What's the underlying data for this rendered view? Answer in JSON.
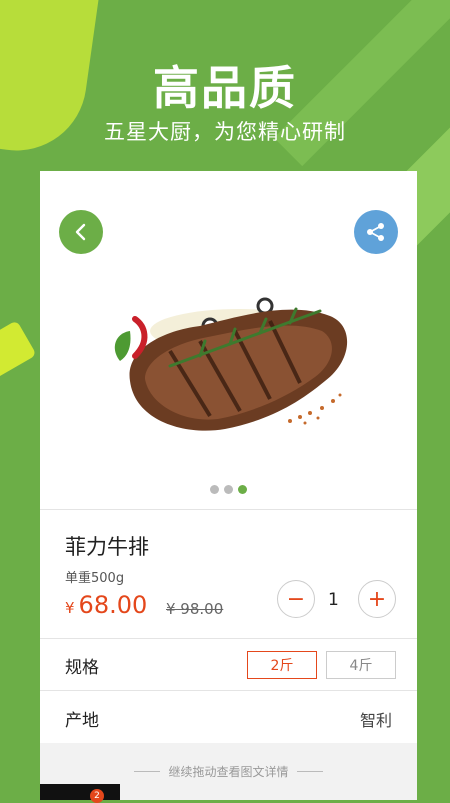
{
  "promo": {
    "headline": "高品质",
    "subline": "五星大厨，为您精心研制"
  },
  "product": {
    "name": "菲力牛排",
    "weight": "单重500g",
    "currency": "¥",
    "price": "68.00",
    "old_price": "¥ 98.00",
    "quantity": "1",
    "minus_label": "−",
    "plus_label": "+"
  },
  "carousel": {
    "count": 3,
    "active_index": 2
  },
  "spec": {
    "label": "规格",
    "options": [
      "2斤",
      "4斤"
    ],
    "selected": "2斤"
  },
  "origin": {
    "label": "产地",
    "value": "智利"
  },
  "footer": {
    "hint": "继续拖动查看图文详情"
  },
  "cart": {
    "badge": "2"
  },
  "colors": {
    "brand_green": "#6cae47",
    "accent_orange": "#e4471b",
    "share_blue": "#5fa2d9"
  },
  "icons": {
    "back": "chevron-left-icon",
    "share": "share-icon"
  }
}
